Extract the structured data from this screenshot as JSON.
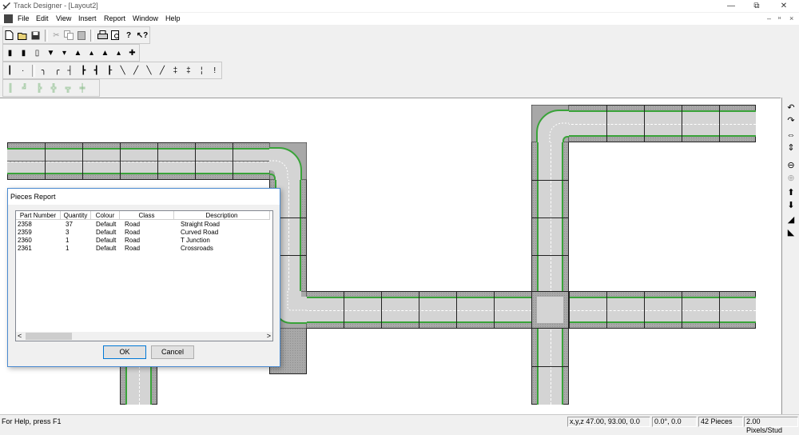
{
  "window": {
    "title": "Track Designer - [Layout2]",
    "minimize": "—",
    "restore": "⧉",
    "close": "✕"
  },
  "menu": {
    "items": [
      "File",
      "Edit",
      "View",
      "Insert",
      "Report",
      "Window",
      "Help"
    ],
    "mdi_min": "–",
    "mdi_restore": "ᵸ",
    "mdi_close": "×"
  },
  "toolbar_icons": {
    "row1": [
      "new-file-icon",
      "open-file-icon",
      "save-icon",
      "cut-icon",
      "copy-icon",
      "paste-icon",
      "print-icon",
      "print-preview-icon",
      "about-icon",
      "context-help-icon"
    ],
    "row2": [
      "pier-1-icon",
      "pier-2-icon",
      "pier-3-icon",
      "pier-4-icon",
      "pier-5-icon",
      "pier-6-icon",
      "pier-7-icon",
      "pier-8-icon",
      "pier-9-icon",
      "pier-10-icon"
    ],
    "row3": [
      "straight-track-icon",
      "short-track-icon",
      "curve-left-icon",
      "curve-right-icon",
      "point-1-icon",
      "point-2-icon",
      "point-3-icon",
      "point-4-icon",
      "crossing-1-icon",
      "crossing-2-icon",
      "flex-1-icon",
      "flex-2-icon",
      "buffer-1-icon",
      "buffer-2-icon",
      "signal-icon",
      "uncoupler-icon"
    ],
    "row4": [
      "road-straight-icon",
      "road-curve-icon",
      "road-t-icon",
      "road-cross-icon",
      "road-end-icon",
      "road-plate-icon"
    ]
  },
  "right_toolbar": [
    "rotate-left-icon",
    "rotate-right-icon",
    "flip-horizontal-icon",
    "flip-vertical-icon",
    "zoom-out-icon",
    "zoom-in-icon",
    "raise-icon",
    "lower-icon",
    "slope-up-icon",
    "slope-down-icon"
  ],
  "dialog": {
    "title": "Pieces Report",
    "columns": [
      "Part Number",
      "Quantity",
      "Colour",
      "Class",
      "Description"
    ],
    "rows": [
      [
        "2358",
        "37",
        "Default",
        "Road",
        "Straight Road"
      ],
      [
        "2359",
        "3",
        "Default",
        "Road",
        "Curved Road"
      ],
      [
        "2360",
        "1",
        "Default",
        "Road",
        "T Junction"
      ],
      [
        "2361",
        "1",
        "Default",
        "Road",
        "Crossroads"
      ]
    ],
    "scroll_left": "<",
    "scroll_right": ">",
    "ok": "OK",
    "cancel": "Cancel"
  },
  "status": {
    "help": "For Help, press F1",
    "coords": "x,y,z 47.00, 93.00, 0.0",
    "angle": "0.0°, 0.0",
    "pieces": "42 Pieces",
    "scale": "2.00 Pixels/Stud"
  },
  "colors": {
    "road_edge": "#39a339",
    "road_surface": "#d4d4d4",
    "baseplate": "#a8a8a8"
  }
}
